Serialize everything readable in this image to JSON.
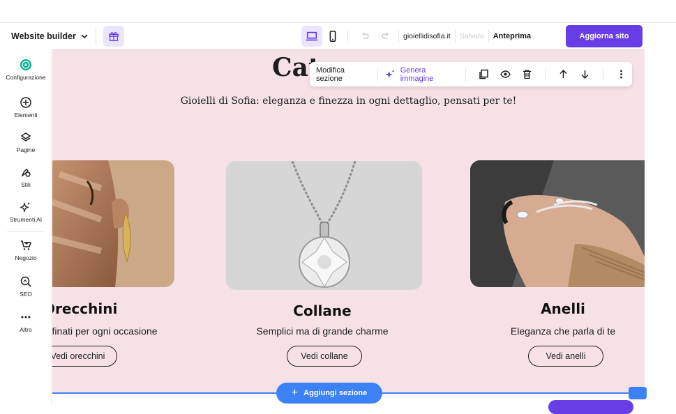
{
  "topbar": {
    "brand_label": "Website builder",
    "domain": "gioiellidisofia.it",
    "saved_label": "Salvato",
    "preview_label": "Anteprima",
    "update_label": "Aggiorna sito"
  },
  "sidebar": {
    "items": [
      {
        "label": "Configurazione",
        "icon": "settings-icon"
      },
      {
        "label": "Elementi",
        "icon": "plus-circle-icon"
      },
      {
        "label": "Pagine",
        "icon": "layers-icon"
      },
      {
        "label": "Stili",
        "icon": "brush-icon"
      },
      {
        "label": "Strumenti AI",
        "icon": "sparkle-icon"
      },
      {
        "label": "Negozio",
        "icon": "cart-icon"
      },
      {
        "label": "SEO",
        "icon": "seo-icon"
      },
      {
        "label": "Altro",
        "icon": "more-icon"
      }
    ]
  },
  "section_toolbar": {
    "edit_label": "Modifica sezione",
    "generate_label": "Genera immagine"
  },
  "section": {
    "title": "Cat",
    "subtitle": "Gioielli di Sofia: eleganza e finezza in ogni dettaglio, pensati per te!",
    "cards": [
      {
        "title": "Orecchini",
        "desc": "Raffinati per ogni occasione",
        "button": "Vedi orecchini"
      },
      {
        "title": "Collane",
        "desc": "Semplici ma di grande charme",
        "button": "Vedi collane"
      },
      {
        "title": "Anelli",
        "desc": "Eleganza che parla di te",
        "button": "Vedi anelli"
      }
    ]
  },
  "bottom": {
    "add_section_label": "Aggiungi sezione"
  },
  "colors": {
    "accent": "#673de6",
    "canvas_bg": "#f6e2e6",
    "selection_blue": "#3c82f6"
  }
}
